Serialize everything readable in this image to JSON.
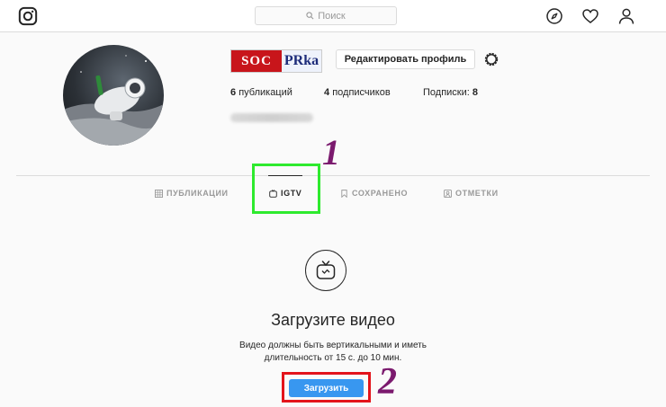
{
  "header": {
    "search_placeholder": "Поиск",
    "icons": [
      "instagram-logo-icon",
      "search-icon",
      "compass-icon",
      "heart-icon",
      "profile-icon"
    ]
  },
  "profile": {
    "username_logo": {
      "part1": "SOC",
      "part2": "PRka"
    },
    "edit_button_label": "Редактировать профиль",
    "stats": {
      "posts_count": "6",
      "posts_label": "публикаций",
      "followers_count": "4",
      "followers_label": "подписчиков",
      "following_label": "Подписки:",
      "following_count": "8"
    }
  },
  "tabs": [
    {
      "label": "ПУБЛИКАЦИИ",
      "icon": "grid-icon",
      "active": false
    },
    {
      "label": "IGTV",
      "icon": "igtv-icon",
      "active": true
    },
    {
      "label": "СОХРАНЕНО",
      "icon": "bookmark-icon",
      "active": false
    },
    {
      "label": "ОТМЕТКИ",
      "icon": "tag-icon",
      "active": false
    }
  ],
  "annotations": {
    "step1": "1",
    "step2": "2"
  },
  "empty_state": {
    "title": "Загрузите видео",
    "text_line1": "Видео должны быть вертикальными и иметь",
    "text_line2": "длительность от 15 с. до 10 мин.",
    "upload_button_label": "Загрузить"
  },
  "colors": {
    "accent": "#3897f0",
    "highlight_green": "#2eea2e",
    "highlight_red": "#e3141b",
    "annotation_purple": "#7b1a6e"
  }
}
